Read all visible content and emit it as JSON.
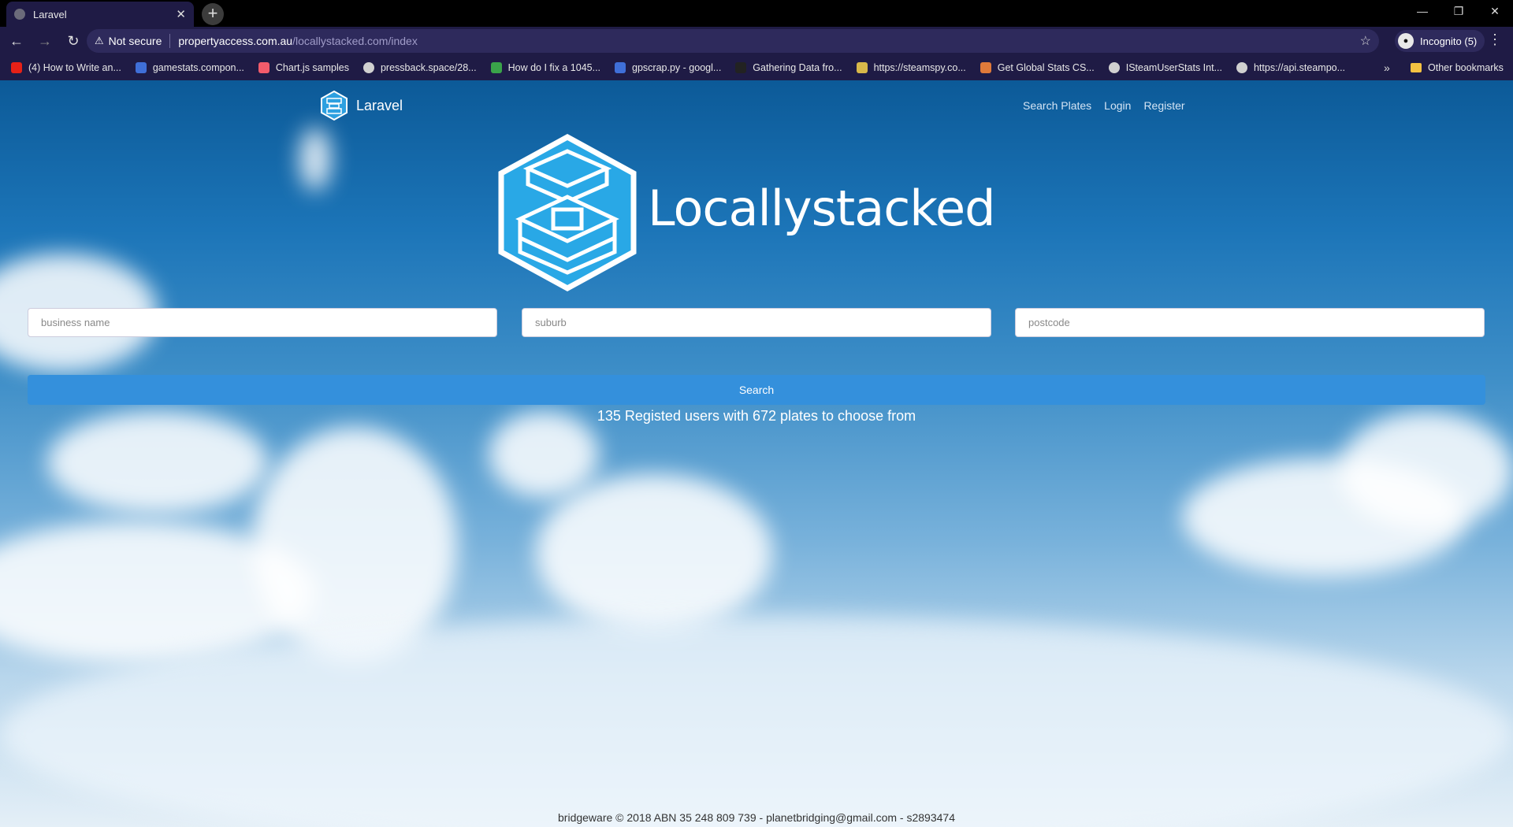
{
  "browser": {
    "tab_title": "Laravel",
    "url_security": "Not secure",
    "url_host": "propertyaccess.com.au",
    "url_path": "/locallystacked.com/index",
    "profile_label": "Incognito (5)",
    "bookmarks": [
      {
        "label": "(4) How to Write an...",
        "color": "#e62117"
      },
      {
        "label": "gamestats.compon...",
        "color": "#3f6fd8"
      },
      {
        "label": "Chart.js samples",
        "color": "#f25b6b"
      },
      {
        "label": "pressback.space/28...",
        "color": "#d0d0d0"
      },
      {
        "label": "How do I fix a 1045...",
        "color": "#3aa34a"
      },
      {
        "label": "gpscrap.py - googl...",
        "color": "#3f6fd8"
      },
      {
        "label": "Gathering Data fro...",
        "color": "#222222"
      },
      {
        "label": "https://steamspy.co...",
        "color": "#d8b84a"
      },
      {
        "label": "Get Global Stats CS...",
        "color": "#e07a3a"
      },
      {
        "label": "ISteamUserStats Int...",
        "color": "#d0d0d0"
      },
      {
        "label": "https://api.steampo...",
        "color": "#d0d0d0"
      }
    ],
    "other_bookmarks": "Other bookmarks"
  },
  "nav": {
    "brand": "Laravel",
    "links": [
      "Search Plates",
      "Login",
      "Register"
    ]
  },
  "hero": {
    "title": "Locallystacked"
  },
  "search": {
    "business_placeholder": "business name",
    "suburb_placeholder": "suburb",
    "postcode_placeholder": "postcode",
    "button_label": "Search"
  },
  "stats": "135 Registed users with 672 plates to choose from",
  "footer": "bridgeware © 2018 ABN 35 248 809 739 - planetbridging@gmail.com - s2893474"
}
